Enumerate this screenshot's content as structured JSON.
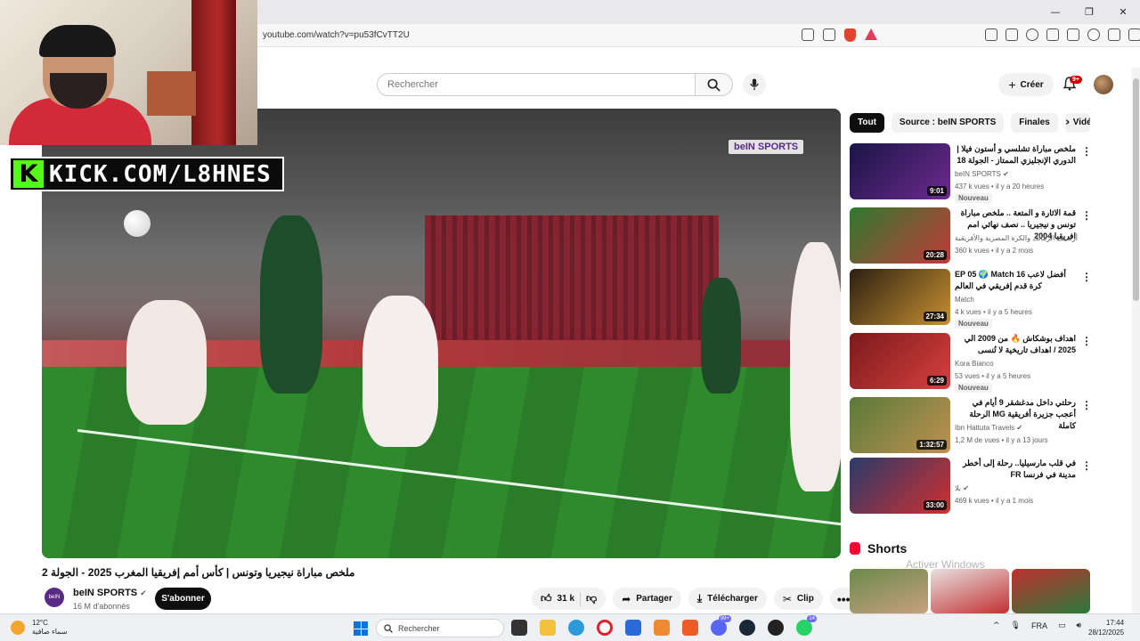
{
  "browser": {
    "url": "youtube.com/watch?v=pu53fCvTT2U",
    "window_controls": [
      "—",
      "❐",
      "✕"
    ],
    "brave_badge": "2"
  },
  "header": {
    "search_placeholder": "Rechercher",
    "create_label": "Créer",
    "notifications_count": "9+"
  },
  "overlay": {
    "kick_letter": "K",
    "kick_text": "KICK.COM/L8HNES",
    "broadcaster_logo": "beIN SPORTS"
  },
  "video": {
    "title": "ملخص مباراة نيجيريا وتونس | كأس أمم إفريقيا المغرب 2025 - الجولة 2",
    "channel": {
      "name": "beIN SPORTS",
      "avatar_text": "beIN",
      "subscribers": "16 M d'abonnés"
    },
    "subscribe_label": "S'abonner",
    "actions": {
      "likes": "31 k",
      "share": "Partager",
      "download": "Télécharger",
      "clip": "Clip"
    }
  },
  "sidebar": {
    "chips": [
      "Tout",
      "Source : beIN SPORTS",
      "Finales",
      "Vidé"
    ],
    "recommendations": [
      {
        "title": "ملخص مباراة تشلسي و أستون فيلا | الدوري الإنجليزي الممتاز - الجولة 18",
        "channel": "beIN SPORTS",
        "verified": true,
        "meta": "437 k vues • il y a 20 heures",
        "badge": "Nouveau",
        "duration": "9:01",
        "thumb_colors": [
          "#1a1446",
          "#6d2b8f"
        ]
      },
      {
        "title": "قمة الاثارة و المتعة .. ملخص مباراة تونس و نيجيريا .. نصف نهائي امم افريقيا 2004",
        "channel": "أرشيف الزمالك والكرة المصرية والأفريقية",
        "verified": false,
        "meta": "360 k vues • il y a 2 mois",
        "badge": "",
        "duration": "20:28",
        "thumb_colors": [
          "#2f7a2e",
          "#c23a3a"
        ]
      },
      {
        "title": "EP 05 🌍 Match 16 أفضل لاعب كرة قدم إفريقي في العالم",
        "channel": "Match",
        "verified": false,
        "meta": "4 k vues • il y a 5 heures",
        "badge": "Nouveau",
        "duration": "27:34",
        "thumb_colors": [
          "#2c2012",
          "#c89030"
        ]
      },
      {
        "title": "اهداف بوشكاش 🔥 من 2009 الي 2025 / اهداف تاريخية لا تُنسى",
        "channel": "Kora Bianco",
        "verified": false,
        "meta": "53 vues • il y a 5 heures",
        "badge": "Nouveau",
        "duration": "6:29",
        "thumb_colors": [
          "#7a1a1a",
          "#d94040"
        ]
      },
      {
        "title": "رحلتي داخل مدغشقر 9 أيام في أعجب جزيرة أفريقية MG الرحلة كاملة",
        "channel": "Ibn Hattuta Travels",
        "verified": true,
        "meta": "1,2 M de vues • il y a 13 jours",
        "badge": "",
        "duration": "1:32:57",
        "thumb_colors": [
          "#5a7a3a",
          "#c09050"
        ]
      },
      {
        "title": "في قلب مارسيليا.. رحلة إلى أخطر مدينة في فرنسا FR",
        "channel": "بلا",
        "verified": true,
        "meta": "469 k vues • il y a 1 mois",
        "badge": "",
        "duration": "33:00",
        "thumb_colors": [
          "#2a3a6a",
          "#d03030"
        ]
      }
    ],
    "shorts_title": "Shorts",
    "watermark": "Activer Windows"
  },
  "taskbar": {
    "temperature": "12°C",
    "weather": "سماء صافية",
    "search_label": "Rechercher",
    "steam_badge": "99+",
    "whatsapp_badge": "14",
    "language": "FRA",
    "time": "17:44",
    "date": "28/12/2025"
  }
}
